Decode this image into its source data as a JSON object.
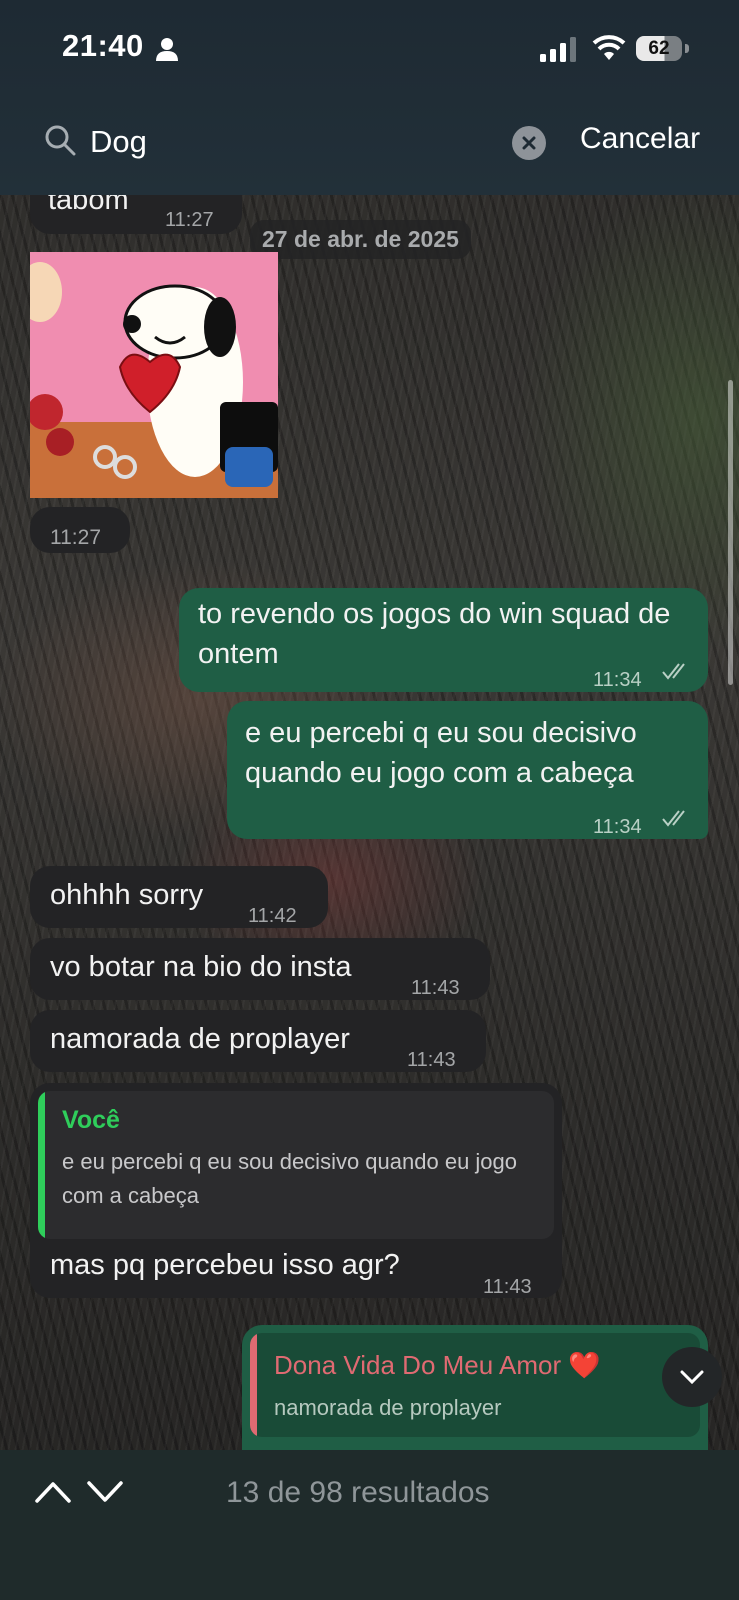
{
  "status_bar": {
    "time": "21:40",
    "battery": "62"
  },
  "search": {
    "query": "Dog",
    "cancel_label": "Cancelar"
  },
  "date_separator": "27 de abr. de 2025",
  "messages": [
    {
      "text": "tabom",
      "time": "11:27"
    },
    {
      "image": "Snoopy-sticker",
      "time": "11:27"
    },
    {
      "text": "to revendo os jogos do win squad de ontem",
      "time": "11:34"
    },
    {
      "text": "e eu percebi q eu sou decisivo quando eu jogo com a cabeça",
      "time": "11:34"
    },
    {
      "text": "ohhhh sorry",
      "time": "11:42"
    },
    {
      "text": "vo botar na bio do insta",
      "time": "11:43"
    },
    {
      "text": "namorada de proplayer",
      "time": "11:43"
    },
    {
      "quote_author": "Você",
      "quote_text": "e eu percebi q eu sou decisivo quando eu jogo com a cabeça",
      "text": "mas pq percebeu isso agr?",
      "time": "11:43"
    },
    {
      "quote_author": "Dona Vida Do Meu Amor ❤️",
      "quote_text": "namorada de proplayer"
    }
  ],
  "footer": {
    "results_text": "13 de 98 resultados"
  },
  "colors": {
    "outgoing": "#1f5e45",
    "incoming": "#232325",
    "quote_green": "#2fce5b",
    "quote_red": "#e06a72"
  }
}
